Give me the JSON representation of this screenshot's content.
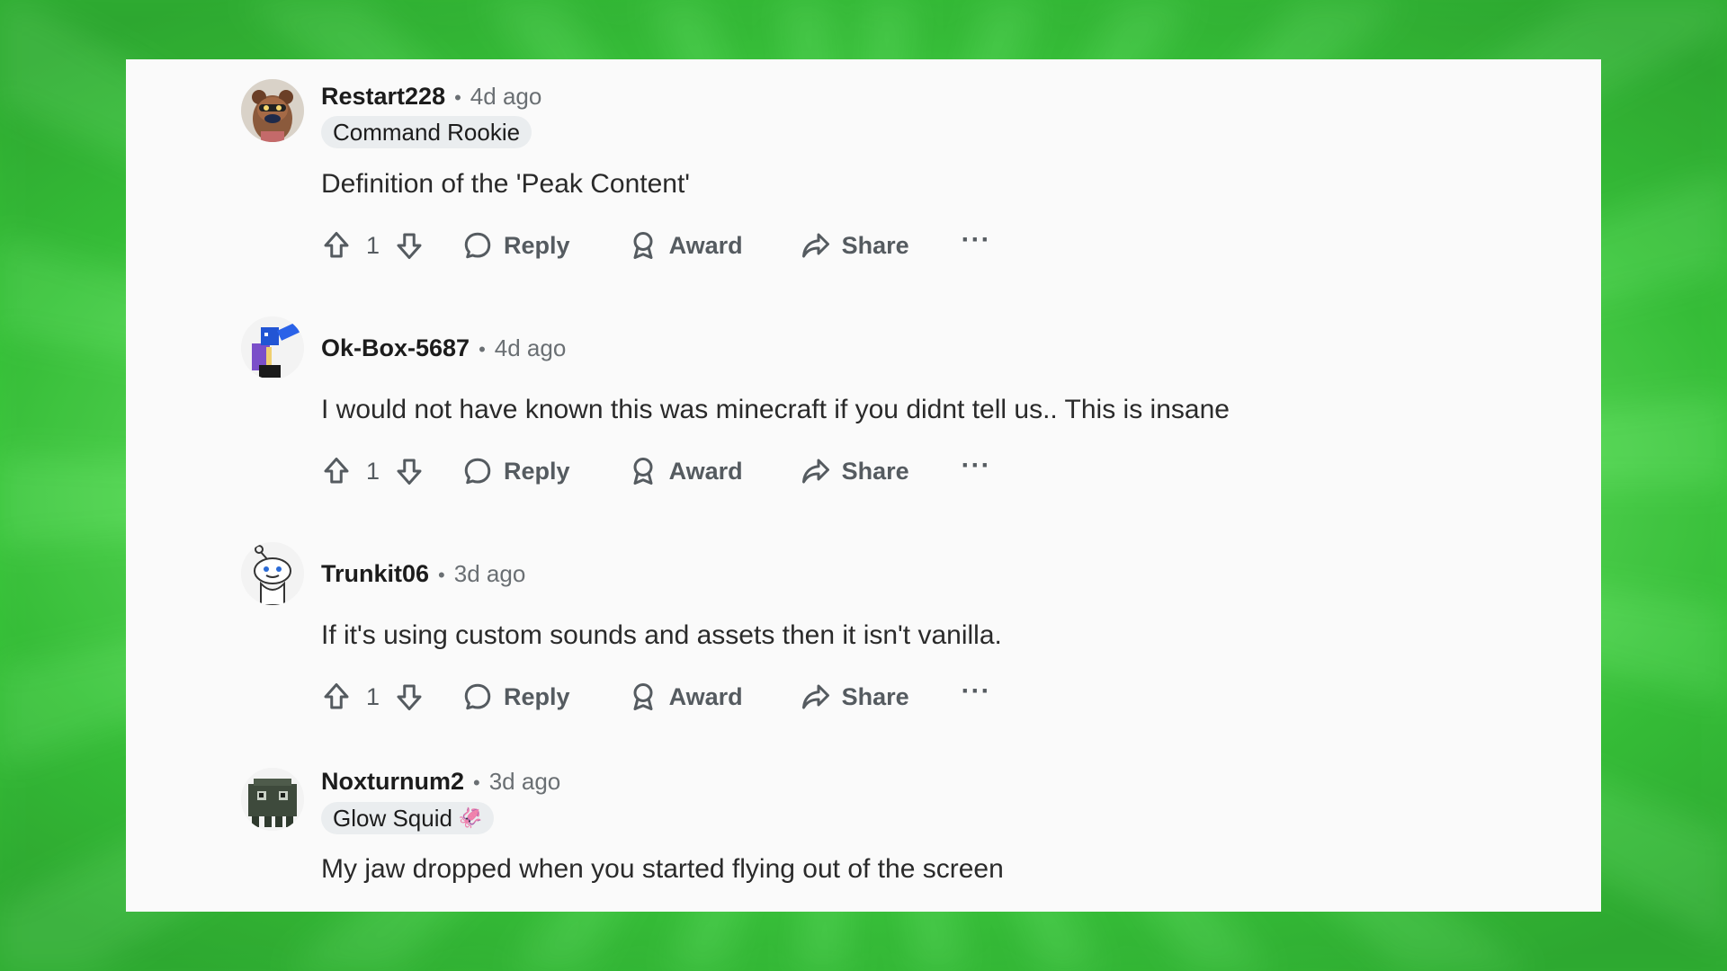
{
  "comments": [
    {
      "username": "Restart228",
      "separator": "•",
      "time": "4d ago",
      "flair": "Command Rookie",
      "body": "Definition of the 'Peak Content'",
      "votes": "1",
      "reply": "Reply",
      "award": "Award",
      "share": "Share",
      "more": "···"
    },
    {
      "username": "Ok-Box-5687",
      "separator": "•",
      "time": "4d ago",
      "body": "I would not have known this was minecraft if you didnt tell us.. This is insane",
      "votes": "1",
      "reply": "Reply",
      "award": "Award",
      "share": "Share",
      "more": "···"
    },
    {
      "username": "Trunkit06",
      "separator": "•",
      "time": "3d ago",
      "body": "If it's using custom sounds and assets then it isn't vanilla.",
      "votes": "1",
      "reply": "Reply",
      "award": "Award",
      "share": "Share",
      "more": "···"
    },
    {
      "username": "Noxturnum2",
      "separator": "•",
      "time": "3d ago",
      "flair": "Glow Squid",
      "flair_emoji": "🦑",
      "body": "My jaw dropped when you started flying out of the screen"
    }
  ],
  "colors": {
    "background_green": "#5fe35c",
    "card": "#fafafa",
    "text_primary": "#1c1c1c",
    "text_secondary": "#555b60",
    "flair_bg": "#eaedef"
  }
}
